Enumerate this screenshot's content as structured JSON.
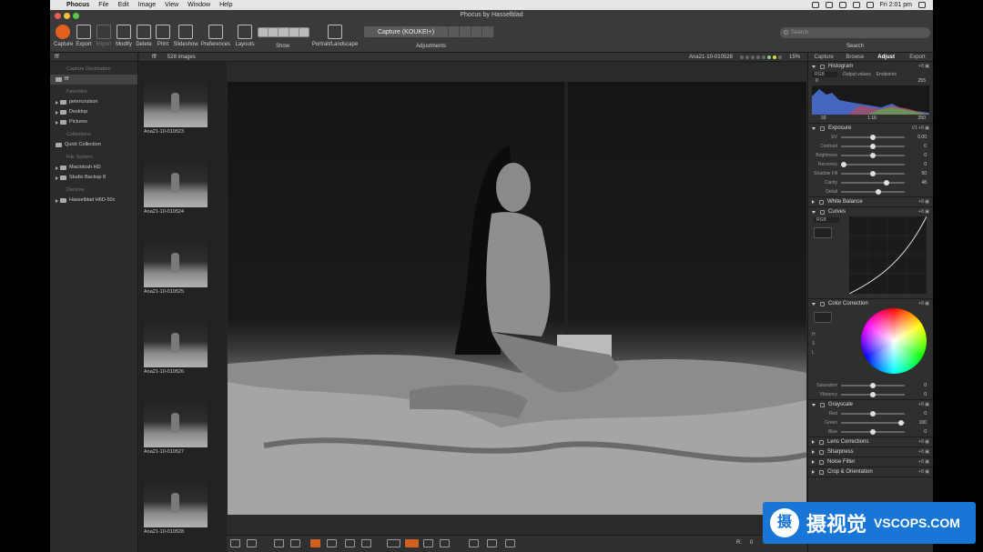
{
  "menubar": {
    "apple": "",
    "app": "Phocus",
    "items": [
      "File",
      "Edit",
      "Image",
      "View",
      "Window",
      "Help"
    ],
    "clock": "Fri 2:01 pm"
  },
  "window": {
    "title": "Phocus by Hasselblad"
  },
  "toolbar": {
    "buttons": [
      {
        "label": "Capture"
      },
      {
        "label": "Export"
      },
      {
        "label": "Import"
      },
      {
        "label": "Modify"
      },
      {
        "label": "Delete"
      },
      {
        "label": "Print"
      },
      {
        "label": "Slideshow"
      },
      {
        "label": "Preferences"
      },
      {
        "label": "Layouts"
      }
    ],
    "show_label": "Show",
    "portrait_label": "Portrait/Landscape",
    "capture_select": "Capture (KOUKEI+)",
    "adjustments_label": "Adjustments",
    "search_placeholder": "Search",
    "search_label": "Search"
  },
  "left": {
    "folder": "fff",
    "sections": {
      "capture": "Capture Destination",
      "favorites": "Favorites",
      "collections": "Collections",
      "filesystem": "File System",
      "devices": "Devices"
    },
    "capture_item": "fff",
    "favorites": [
      "petercoulson",
      "Desktop",
      "Pictures"
    ],
    "collections": [
      "Quick Collection"
    ],
    "filesystem": [
      "Macintosh HD",
      "Studio Backup 8"
    ],
    "devices": [
      "Hasselblad H6D-50c"
    ]
  },
  "browser": {
    "folder": "fff",
    "count": "528 images",
    "thumbs": [
      "Ana21-10-010523",
      "Ana21-10-010524",
      "Ana21-10-010525",
      "Ana21-10-010526",
      "Ana21-10-010527",
      "Ana21-10-010528"
    ]
  },
  "viewer": {
    "filename": "Ana21-10-010528",
    "zoom": "15%",
    "footer_r": "R:",
    "footer_val": "0"
  },
  "adjust": {
    "tabs": [
      "Capture",
      "Browse",
      "Adjust",
      "Export"
    ],
    "active_tab": "Adjust",
    "histogram": {
      "title": "Histogram",
      "mode": "RGB",
      "output": "Output values",
      "endpoints": "Endpoints",
      "in_lo": "0",
      "in_hi": "255",
      "out_lo": "33",
      "mid": "1.16",
      "out_hi": "250"
    },
    "exposure": {
      "title": "Exposure",
      "version": "V1",
      "sliders": [
        {
          "label": "EV",
          "value": "0.00",
          "pos": 0.5
        },
        {
          "label": "Contrast",
          "value": "0",
          "pos": 0.5
        },
        {
          "label": "Brightness",
          "value": "0",
          "pos": 0.5
        },
        {
          "label": "Recovery",
          "value": "0",
          "pos": 0.0
        },
        {
          "label": "Shadow Fill",
          "value": "50",
          "pos": 0.5
        },
        {
          "label": "Clarity",
          "value": "48",
          "pos": 0.74
        },
        {
          "label": "Detail",
          "value": "",
          "pos": 0.6
        }
      ]
    },
    "white_balance": {
      "title": "White Balance"
    },
    "curves": {
      "title": "Curves",
      "mode": "RGB"
    },
    "color_correction": {
      "title": "Color Correction",
      "hsl": [
        {
          "label": "H"
        },
        {
          "label": "S"
        },
        {
          "label": "L"
        }
      ],
      "sliders": [
        {
          "label": "Saturation",
          "value": "0",
          "pos": 0.5
        },
        {
          "label": "Vibrancy",
          "value": "0",
          "pos": 0.5
        }
      ]
    },
    "grayscale": {
      "title": "Grayscale",
      "sliders": [
        {
          "label": "Red",
          "value": "0",
          "pos": 0.5
        },
        {
          "label": "Green",
          "value": "100",
          "pos": 0.98
        },
        {
          "label": "Blue",
          "value": "0",
          "pos": 0.5
        }
      ]
    },
    "collapsed": [
      "Lens Corrections",
      "Sharpness",
      "Noise Filter",
      "Crop & Orientation"
    ]
  },
  "watermark": {
    "cn": "摄视觉",
    "en": "VSCOPS.COM",
    "logo": "摄"
  }
}
